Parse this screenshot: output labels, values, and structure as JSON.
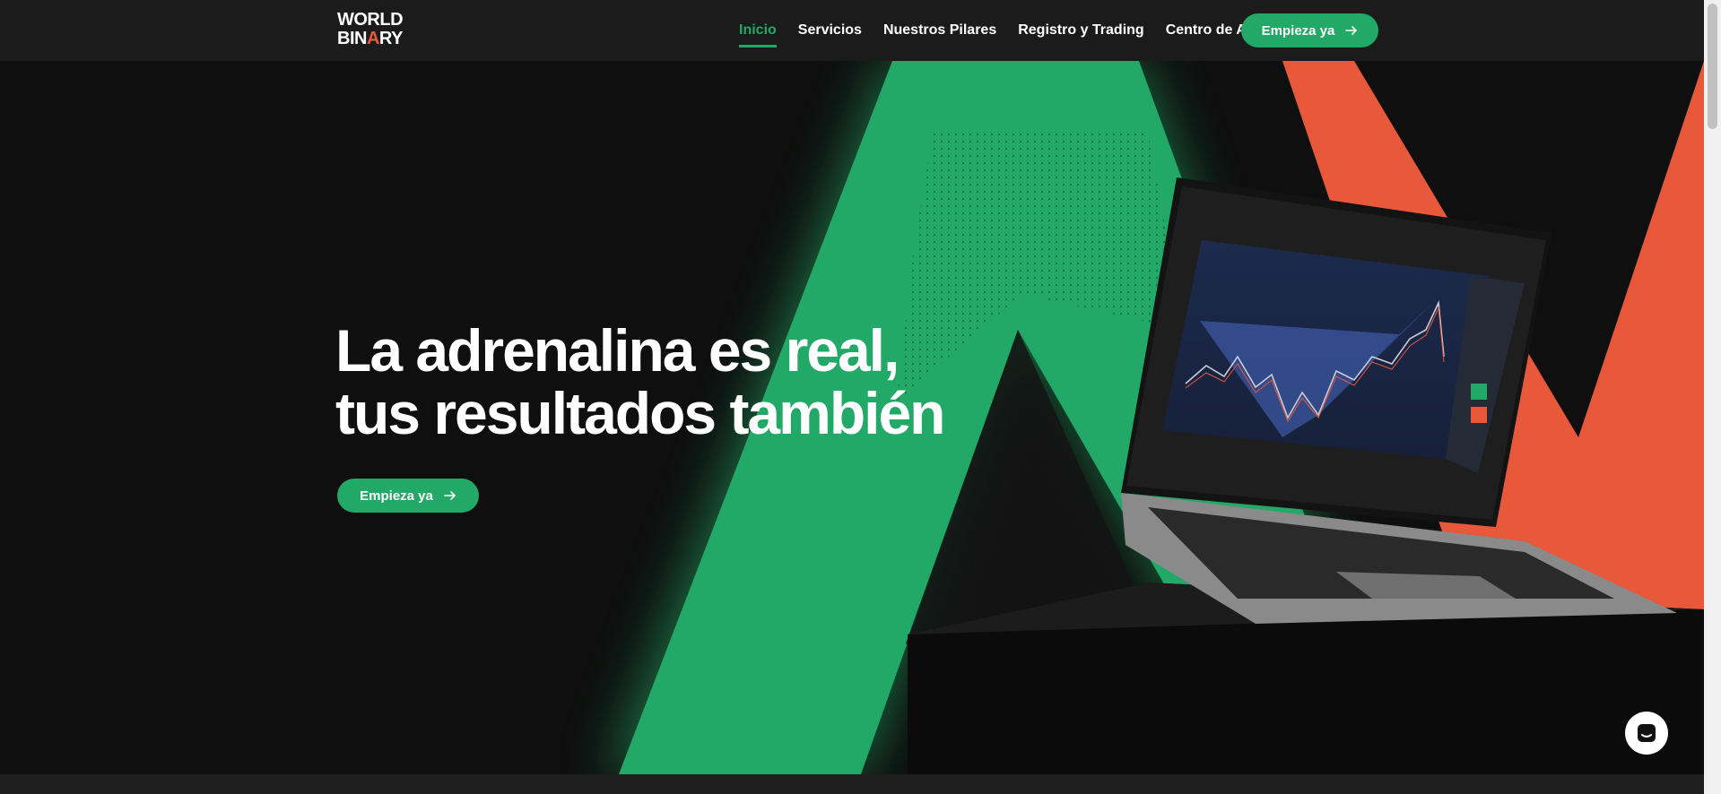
{
  "brand": {
    "line1": "WORLD",
    "line2_a": "BIN",
    "line2_b": "A",
    "line2_c": "RY"
  },
  "nav": {
    "items": [
      {
        "label": "Inicio",
        "active": true
      },
      {
        "label": "Servicios"
      },
      {
        "label": "Nuestros Pilares"
      },
      {
        "label": "Registro y Trading"
      },
      {
        "label": "Centro de Ayuda"
      }
    ],
    "cta_label": "Empieza ya"
  },
  "hero": {
    "headline_line1": "La adrenalina es real,",
    "headline_line2": "tus resultados también",
    "cta_label": "Empieza ya"
  },
  "colors": {
    "accent_green": "#22a867",
    "accent_orange": "#e8583a",
    "background": "#0f0f0f"
  },
  "icons": {
    "arrow": "arrow-right-icon",
    "chat": "chat-icon"
  }
}
